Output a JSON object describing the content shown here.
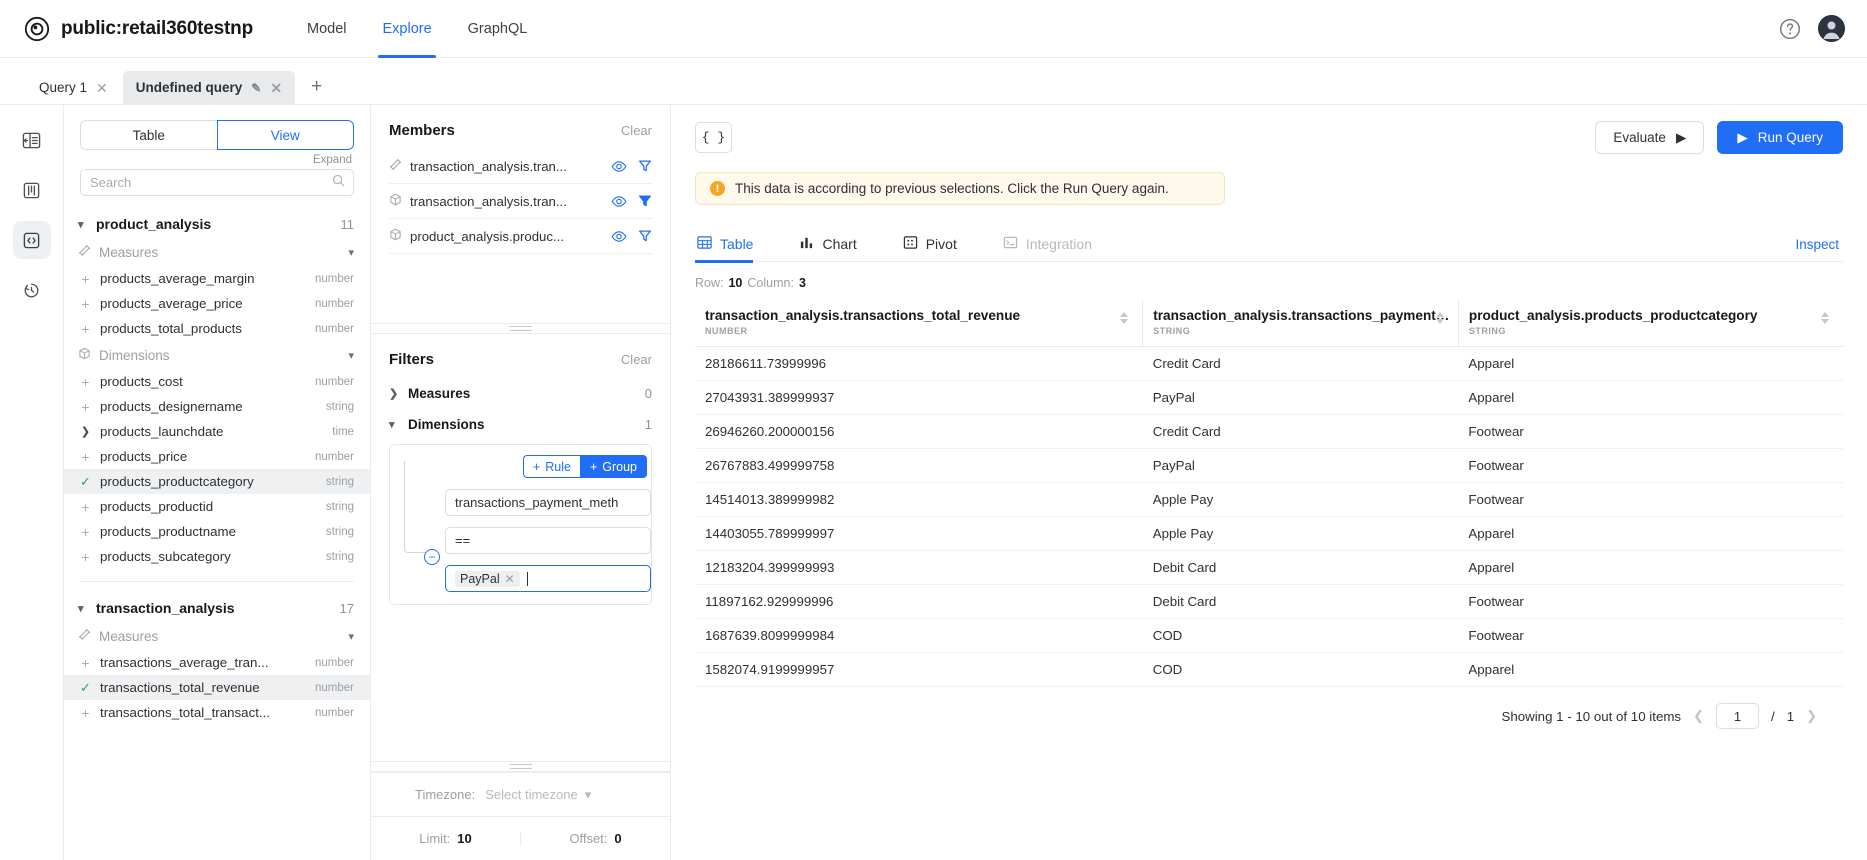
{
  "header": {
    "brand": "public:retail360testnp",
    "logo_icon": "target-circle-icon",
    "nav": [
      {
        "label": "Model",
        "active": false
      },
      {
        "label": "Explore",
        "active": true
      },
      {
        "label": "GraphQL",
        "active": false
      }
    ],
    "help_icon": "question-circle-icon",
    "avatar_icon": "user-avatar"
  },
  "query_tabs": {
    "tabs": [
      {
        "label": "Query 1",
        "active": false,
        "editable": false
      },
      {
        "label": "Undefined query",
        "active": true,
        "editable": true
      }
    ],
    "add_label": "+"
  },
  "rail": {
    "items": [
      {
        "name": "collapse-panel-icon",
        "active": false
      },
      {
        "name": "board-icon",
        "active": false
      },
      {
        "name": "code-icon",
        "active": true
      },
      {
        "name": "history-icon",
        "active": false
      }
    ]
  },
  "explorer": {
    "segments": [
      {
        "label": "Table",
        "active": false
      },
      {
        "label": "View",
        "active": true
      }
    ],
    "expand_label": "Expand",
    "search_placeholder": "Search",
    "search_value": "",
    "cubes": [
      {
        "name": "product_analysis",
        "count": "11",
        "expanded": true,
        "groups": [
          {
            "label": "Measures",
            "icon": "measures-icon",
            "items": [
              {
                "label": "products_average_margin",
                "type": "number",
                "state": "add"
              },
              {
                "label": "products_average_price",
                "type": "number",
                "state": "add"
              },
              {
                "label": "products_total_products",
                "type": "number",
                "state": "add"
              }
            ]
          },
          {
            "label": "Dimensions",
            "icon": "dimensions-icon",
            "items": [
              {
                "label": "products_cost",
                "type": "number",
                "state": "add"
              },
              {
                "label": "products_designername",
                "type": "string",
                "state": "add"
              },
              {
                "label": "products_launchdate",
                "type": "time",
                "state": "expand"
              },
              {
                "label": "products_price",
                "type": "number",
                "state": "add"
              },
              {
                "label": "products_productcategory",
                "type": "string",
                "state": "selected"
              },
              {
                "label": "products_productid",
                "type": "string",
                "state": "add"
              },
              {
                "label": "products_productname",
                "type": "string",
                "state": "add"
              },
              {
                "label": "products_subcategory",
                "type": "string",
                "state": "add"
              }
            ]
          }
        ]
      },
      {
        "name": "transaction_analysis",
        "count": "17",
        "expanded": true,
        "groups": [
          {
            "label": "Measures",
            "icon": "measures-icon",
            "items": [
              {
                "label": "transactions_average_tran...",
                "type": "number",
                "state": "add"
              },
              {
                "label": "transactions_total_revenue",
                "type": "number",
                "state": "selected"
              },
              {
                "label": "transactions_total_transact...",
                "type": "number",
                "state": "add"
              }
            ]
          }
        ]
      }
    ]
  },
  "members_panel": {
    "title": "Members",
    "clear_label": "Clear",
    "rows": [
      {
        "icon": "measures-icon",
        "label": "transaction_analysis.tran...",
        "eye": "eye-icon",
        "filter": "filter-outline-icon"
      },
      {
        "icon": "dimensions-icon",
        "label": "transaction_analysis.tran...",
        "eye": "eye-icon",
        "filter": "filter-filled-icon"
      },
      {
        "icon": "dimensions-icon",
        "label": "product_analysis.produc...",
        "eye": "eye-icon",
        "filter": "filter-outline-icon"
      }
    ]
  },
  "filters_panel": {
    "title": "Filters",
    "clear_label": "Clear",
    "groups": [
      {
        "label": "Measures",
        "count": "0",
        "expanded": false
      },
      {
        "label": "Dimensions",
        "count": "1",
        "expanded": true
      }
    ],
    "rule": {
      "add_rule_label": "Rule",
      "add_group_label": "Group",
      "field_value": "transactions_payment_meth",
      "operator_value": "==",
      "values": [
        {
          "label": "PayPal"
        }
      ]
    },
    "timezone_label": "Timezone:",
    "timezone_placeholder": "Select timezone",
    "limit_label": "Limit:",
    "limit_value": "10",
    "offset_label": "Offset:",
    "offset_value": "0"
  },
  "main": {
    "json_button_label": "{ }",
    "evaluate_label": "Evaluate",
    "run_query_label": "Run Query",
    "alert_text": "This data is according to previous selections. Click the Run Query again.",
    "tabs": [
      {
        "label": "Table",
        "icon": "table-icon",
        "active": true,
        "disabled": false
      },
      {
        "label": "Chart",
        "icon": "bar-chart-icon",
        "active": false,
        "disabled": false
      },
      {
        "label": "Pivot",
        "icon": "pivot-icon",
        "active": false,
        "disabled": false
      },
      {
        "label": "Integration",
        "icon": "terminal-icon",
        "active": false,
        "disabled": true
      }
    ],
    "inspect_label": "Inspect",
    "row_label": "Row:",
    "row_count": "10",
    "column_label": "Column:",
    "column_count": "3",
    "table": {
      "columns": [
        {
          "title": "transaction_analysis.transactions_total_revenue",
          "type": "NUMBER"
        },
        {
          "title": "transaction_analysis.transactions_payment_method",
          "type": "STRING"
        },
        {
          "title": "product_analysis.products_productcategory",
          "type": "STRING"
        }
      ],
      "rows": [
        [
          "28186611.73999996",
          "Credit Card",
          "Apparel"
        ],
        [
          "27043931.389999937",
          "PayPal",
          "Apparel"
        ],
        [
          "26946260.200000156",
          "Credit Card",
          "Footwear"
        ],
        [
          "26767883.499999758",
          "PayPal",
          "Footwear"
        ],
        [
          "14514013.389999982",
          "Apple Pay",
          "Footwear"
        ],
        [
          "14403055.789999997",
          "Apple Pay",
          "Apparel"
        ],
        [
          "12183204.399999993",
          "Debit Card",
          "Apparel"
        ],
        [
          "11897162.929999996",
          "Debit Card",
          "Footwear"
        ],
        [
          "1687639.8099999984",
          "COD",
          "Footwear"
        ],
        [
          "1582074.9199999957",
          "COD",
          "Apparel"
        ]
      ]
    },
    "pagination": {
      "showing_text": "Showing 1 - 10 out of 10 items",
      "prev_icon": "chevron-left-icon",
      "page_value": "1",
      "separator": "/",
      "total_pages": "1",
      "next_icon": "chevron-right-icon"
    }
  },
  "colors": {
    "accent": "#1f6ef5",
    "warning_bg": "#fff9ec",
    "warning_border": "#f6e4be",
    "warning_icon": "#f5a623",
    "success_tick": "#2aa84a"
  }
}
